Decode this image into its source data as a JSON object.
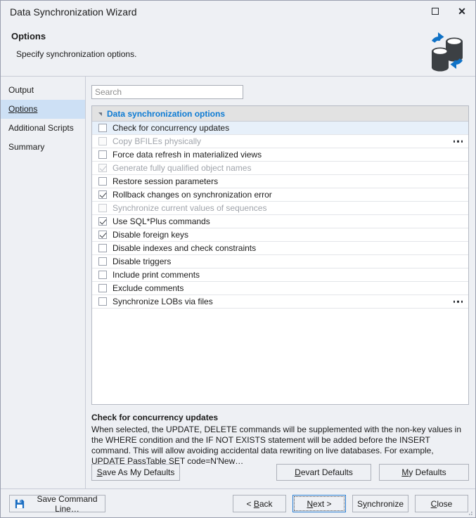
{
  "window": {
    "title": "Data Synchronization Wizard",
    "maximize_label": "Maximize",
    "close_label": "✕"
  },
  "header": {
    "title": "Options",
    "subtitle": "Specify synchronization options.",
    "logo_icon": "database-sync-icon"
  },
  "sidebar": {
    "items": [
      {
        "label": "Output",
        "selected": false
      },
      {
        "label": "Options",
        "selected": true
      },
      {
        "label": "Additional Scripts",
        "selected": false
      },
      {
        "label": "Summary",
        "selected": false
      }
    ]
  },
  "search": {
    "value": "",
    "placeholder": "Search"
  },
  "options_group": {
    "title": "Data synchronization options",
    "expanded": true,
    "items": [
      {
        "label": "Check for concurrency updates",
        "checked": false,
        "disabled": false,
        "selected": true,
        "ellipsis": false
      },
      {
        "label": "Copy BFILEs physically",
        "checked": false,
        "disabled": true,
        "selected": false,
        "ellipsis": true
      },
      {
        "label": "Force data refresh in materialized views",
        "checked": false,
        "disabled": false,
        "selected": false,
        "ellipsis": false
      },
      {
        "label": "Generate fully qualified object names",
        "checked": true,
        "disabled": true,
        "selected": false,
        "ellipsis": false
      },
      {
        "label": "Restore session parameters",
        "checked": false,
        "disabled": false,
        "selected": false,
        "ellipsis": false
      },
      {
        "label": "Rollback changes on synchronization error",
        "checked": true,
        "disabled": false,
        "selected": false,
        "ellipsis": false
      },
      {
        "label": "Synchronize current values of sequences",
        "checked": false,
        "disabled": true,
        "selected": false,
        "ellipsis": false
      },
      {
        "label": "Use SQL*Plus commands",
        "checked": true,
        "disabled": false,
        "selected": false,
        "ellipsis": false
      },
      {
        "label": "Disable foreign keys",
        "checked": true,
        "disabled": false,
        "selected": false,
        "ellipsis": false
      },
      {
        "label": "Disable indexes and check constraints",
        "checked": false,
        "disabled": false,
        "selected": false,
        "ellipsis": false
      },
      {
        "label": "Disable triggers",
        "checked": false,
        "disabled": false,
        "selected": false,
        "ellipsis": false
      },
      {
        "label": "Include print comments",
        "checked": false,
        "disabled": false,
        "selected": false,
        "ellipsis": false
      },
      {
        "label": "Exclude comments",
        "checked": false,
        "disabled": false,
        "selected": false,
        "ellipsis": false
      },
      {
        "label": "Synchronize LOBs via files",
        "checked": false,
        "disabled": false,
        "selected": false,
        "ellipsis": true
      }
    ]
  },
  "description": {
    "title": "Check for concurrency updates",
    "text": "When selected, the UPDATE, DELETE commands will be supplemented with the non-key values in the WHERE condition and the IF NOT EXISTS statement will be added before the INSERT command. This will allow avoiding accidental data rewriting on live databases. For example, UPDATE PassTable SET code=N'New…"
  },
  "defaults_buttons": {
    "save_as_my_defaults": "Save As My Defaults",
    "save_as_my_defaults_accel": "S",
    "devart_defaults": "Devart Defaults",
    "devart_defaults_accel": "D",
    "my_defaults": "My Defaults",
    "my_defaults_accel": "M"
  },
  "footer": {
    "save_command_line": "Save Command Line…",
    "save_icon": "floppy-save-icon",
    "back": "< Back",
    "back_accel": "B",
    "next": "Next >",
    "next_accel": "N",
    "next_focused": true,
    "synchronize": "Synchronize",
    "synchronize_accel": "y",
    "close": "Close",
    "close_accel": "C"
  },
  "colors": {
    "accent_blue": "#0d7bd4",
    "selection_blue": "#cde0f5",
    "row_selection": "#e7f0fa",
    "chrome": "#eef0f4",
    "focus_border": "#2a7dd1"
  }
}
